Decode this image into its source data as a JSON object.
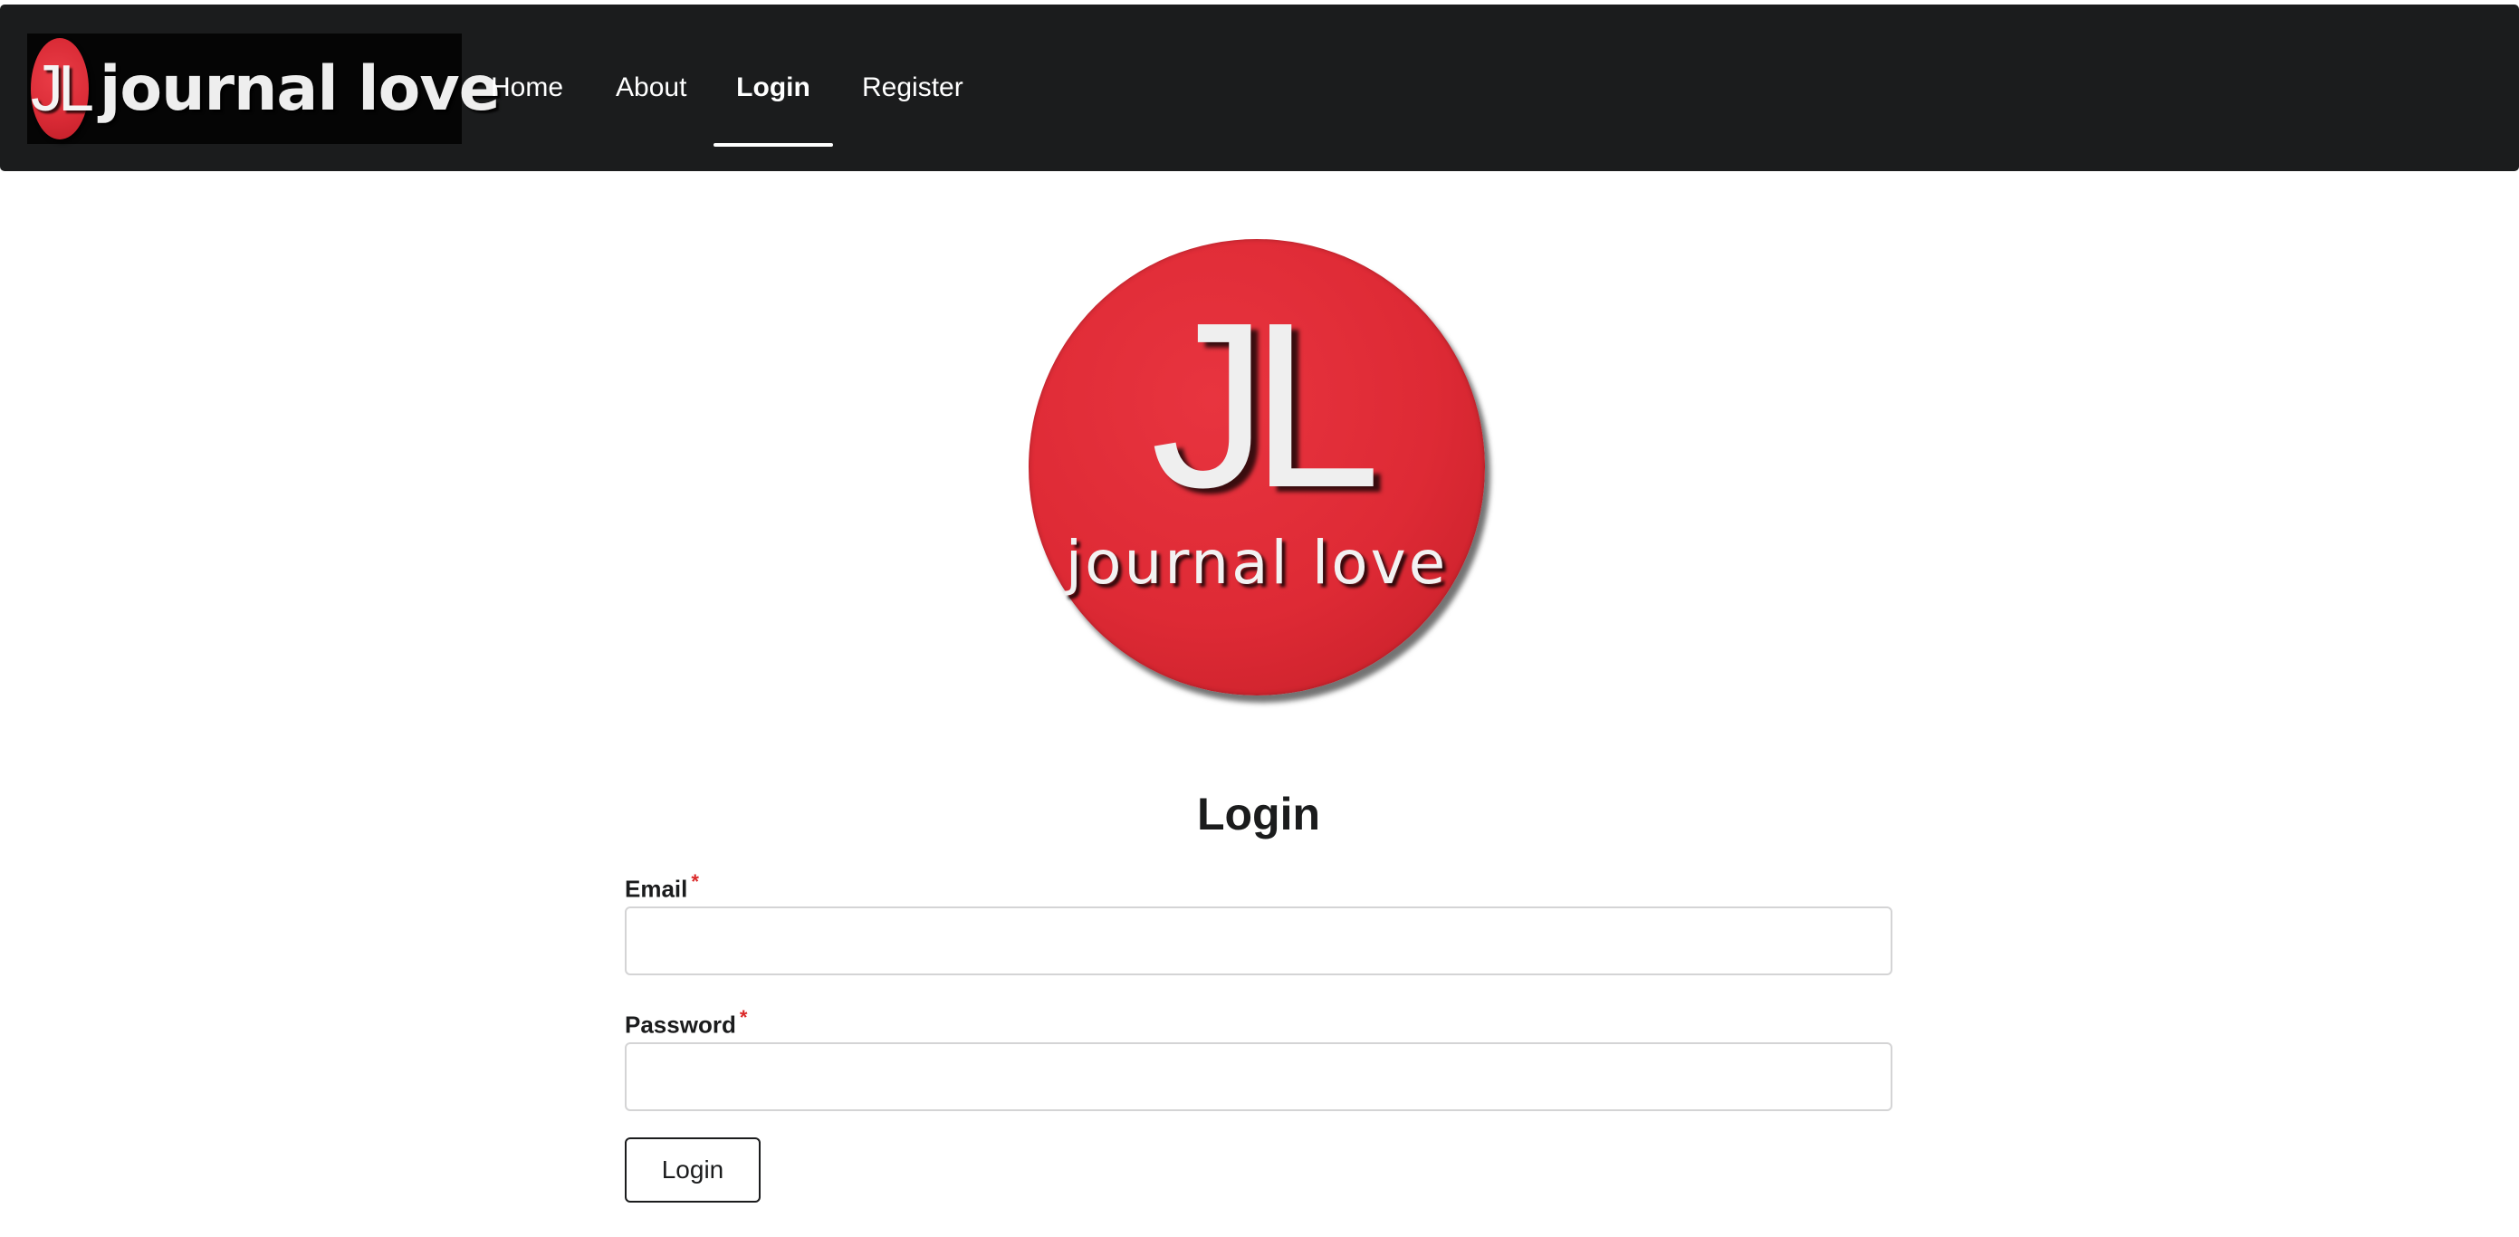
{
  "header": {
    "brand": {
      "initials": "JL",
      "wordmark": "journal love"
    },
    "nav": [
      {
        "label": "Home"
      },
      {
        "label": "About"
      },
      {
        "label": "Login",
        "active": true
      },
      {
        "label": "Register"
      }
    ]
  },
  "hero": {
    "initials": "JL",
    "wordmark": "journal love"
  },
  "form": {
    "title": "Login",
    "email": {
      "label": "Email",
      "required_mark": "*",
      "value": ""
    },
    "password": {
      "label": "Password",
      "required_mark": "*",
      "value": ""
    },
    "submit_label": "Login"
  },
  "colors": {
    "menu_bg": "#1b1c1d",
    "brand_red": "#de2a35",
    "required": "#db2828",
    "input_border": "#d4d4d5"
  }
}
